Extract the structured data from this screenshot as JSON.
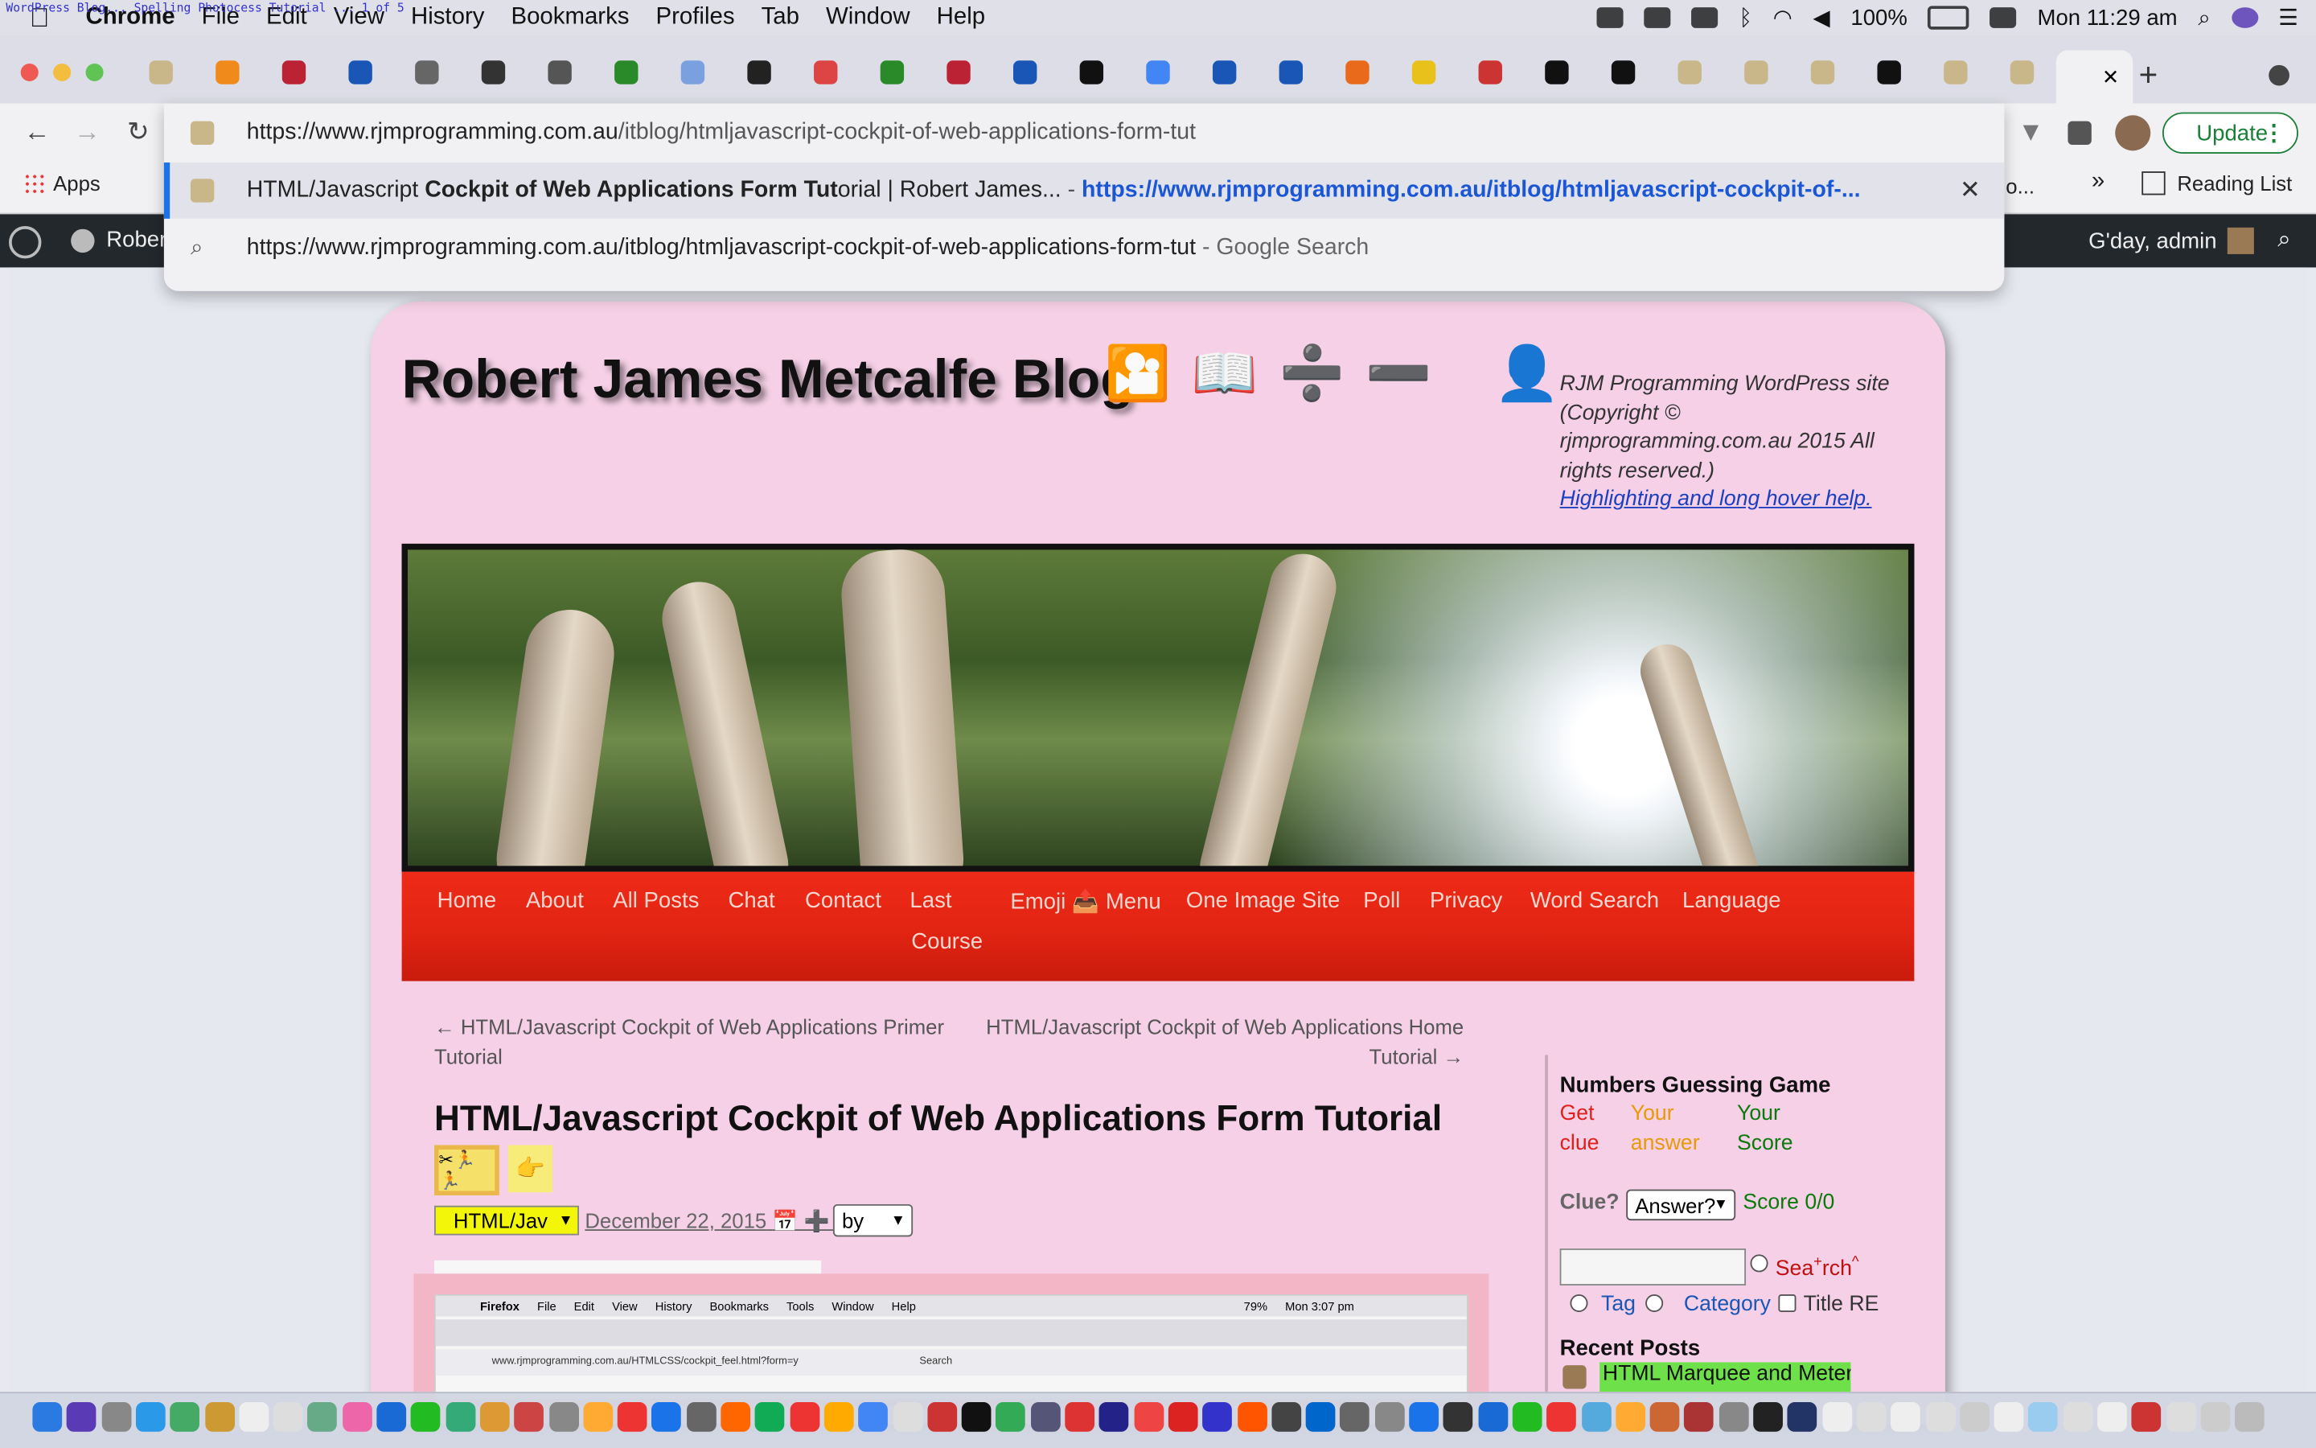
{
  "menubar": {
    "app": "Chrome",
    "items": [
      "File",
      "Edit",
      "View",
      "History",
      "Bookmarks",
      "Profiles",
      "Tab",
      "Window",
      "Help"
    ],
    "battery": "100%",
    "clock": "Mon 11:29 am",
    "ghost_text": "WordPress Blog... Spelling Photocess Tutorial ... 1 of 5"
  },
  "toolbar": {
    "url_host": "https://www.rjmprogramming.com.au",
    "url_path": "/itblog/htmljavascript-cockpit-of-web-applications-form-tut",
    "update_label": "Update"
  },
  "omnibox": {
    "suggestion_title_pre": "HTML/Javascript ",
    "suggestion_title_bold": "Cockpit of Web Applications Form Tut",
    "suggestion_title_post": "orial | Robert James...",
    "suggestion_sep": " - ",
    "suggestion_url": "https://www.rjmprogramming.com.au/itblog/htmljavascript-cockpit-of-...",
    "remove_label": "✕",
    "search_text": "https://www.rjmprogramming.com.au/itblog/htmljavascript-cockpit-of-web-applications-form-tut",
    "search_suffix": " - Google Search"
  },
  "bookmarks": {
    "apps_label": "Apps",
    "more_label": "»",
    "reading_list_label": "Reading List",
    "clipped_text": "o..."
  },
  "wpbar": {
    "site_label": "Robert",
    "greeting": "G'day, admin"
  },
  "site": {
    "title": "Robert James Metcalfe Blog",
    "title_icons": [
      "🎦",
      "📖",
      "➗",
      "➖",
      "👤"
    ],
    "tagline": "RJM Programming WordPress site (Copyright © rjmprogramming.com.au 2015 All rights reserved.)",
    "help_link": "Highlighting and long hover help."
  },
  "nav": {
    "items": [
      "Home",
      "About",
      "All Posts",
      "Chat",
      "Contact",
      "Last",
      "Course",
      "Emoji 📤 Menu",
      "One Image Site",
      "Poll",
      "Privacy",
      "Word Search",
      "Language"
    ]
  },
  "post": {
    "prev": "← HTML/Javascript Cockpit of Web Applications Primer Tutorial",
    "prev_line1": "← HTML/Javascript Cockpit of Web Applications Primer",
    "prev_line2": "Tutorial",
    "next_line1": "HTML/Javascript Cockpit of Web Applications Home",
    "next_line2": "Tutorial →",
    "title": "HTML/Javascript Cockpit of Web Applications Form Tutorial",
    "category_select": "HTML/Jav",
    "date": "December 22, 2015",
    "date_icons": "📅 ➕ 📧",
    "by_select": "by",
    "badge1": "✂🏃🏃",
    "badge2": "👉"
  },
  "embedded_screenshot": {
    "menu": [
      "Firefox",
      "File",
      "Edit",
      "View",
      "History",
      "Bookmarks",
      "Tools",
      "Window",
      "Help"
    ],
    "clock": "Mon 3:07 pm",
    "battery": "79%",
    "address": "www.rjmprogramming.com.au/HTMLCSS/cockpit_feel.html?form=y",
    "search": "Search"
  },
  "sidebar": {
    "game_title": "Numbers Guessing Game",
    "col1": [
      "Get",
      "clue"
    ],
    "col2": [
      "Your",
      "answer"
    ],
    "col3": [
      "Your",
      "Score"
    ],
    "clue_label": "Clue?",
    "answer_select": "Answer?",
    "score": "Score 0/0",
    "search_label_a": "Sea",
    "search_label_b": "rch",
    "radio_tag": "Tag",
    "radio_category": "Category",
    "check_title": "Title RE",
    "recent_title": "Recent Posts",
    "recent_item": "HTML Marquee and Meter"
  },
  "colors": {
    "card_bg": "#f5d0e6",
    "nav_red": "#e22412",
    "link_blue": "#1a3fbf",
    "update_green": "#1a7f37"
  }
}
